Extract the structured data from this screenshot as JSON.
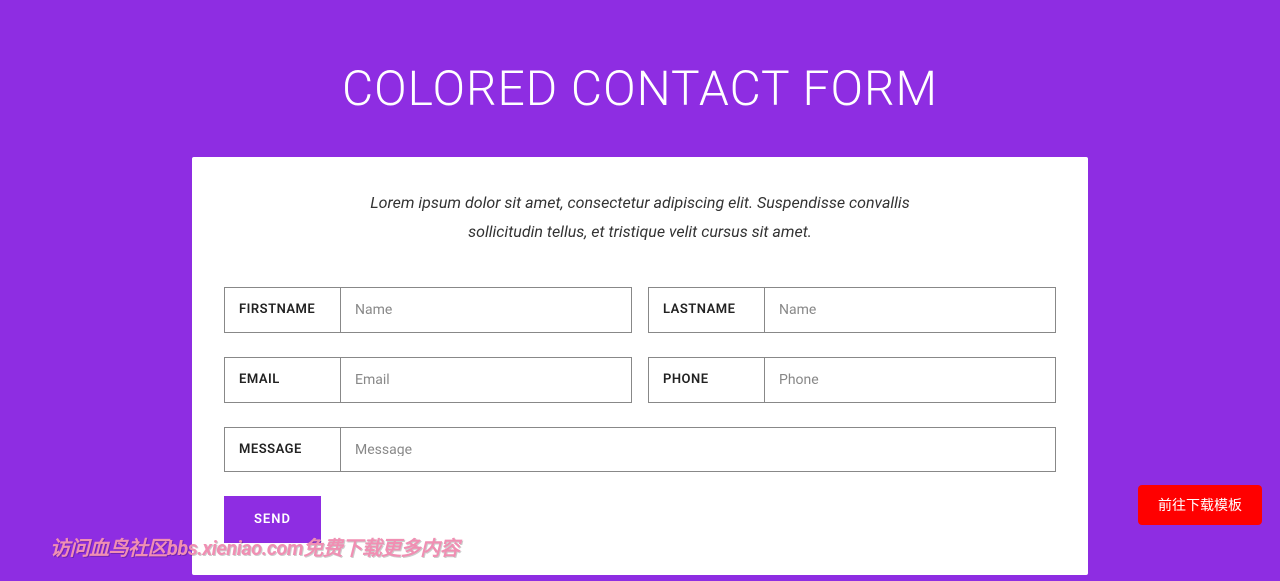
{
  "header": {
    "title": "COLORED CONTACT FORM"
  },
  "card": {
    "intro": "Lorem ipsum dolor sit amet, consectetur adipiscing elit. Suspendisse convallis sollicitudin tellus, et tristique velit cursus sit amet."
  },
  "form": {
    "firstname": {
      "label": "FIRSTNAME",
      "placeholder": "Name",
      "value": ""
    },
    "lastname": {
      "label": "LASTNAME",
      "placeholder": "Name",
      "value": ""
    },
    "email": {
      "label": "EMAIL",
      "placeholder": "Email",
      "value": ""
    },
    "phone": {
      "label": "PHONE",
      "placeholder": "Phone",
      "value": ""
    },
    "message": {
      "label": "MESSAGE",
      "placeholder": "Message",
      "value": ""
    },
    "send_label": "SEND"
  },
  "floating": {
    "download_label": "前往下载模板"
  },
  "watermark": {
    "text": "访问血鸟社区bbs.xieniao.com免费下载更多内容"
  }
}
